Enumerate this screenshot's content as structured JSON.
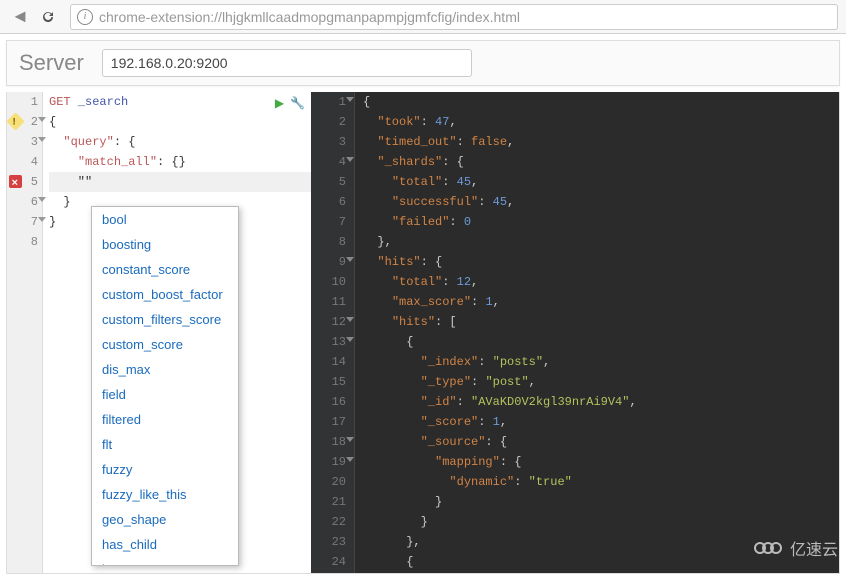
{
  "toolbar": {
    "url": "chrome-extension://lhjgkmllcaadmopgmanpapmpjgmfcfig/index.html"
  },
  "server": {
    "label": "Server",
    "value": "192.168.0.20:9200"
  },
  "request": {
    "method": "GET",
    "path": "_search",
    "lines": [
      {
        "n": "1",
        "mark": "",
        "content_type": "method"
      },
      {
        "n": "2",
        "mark": "warn",
        "content": "{"
      },
      {
        "n": "3",
        "mark": "",
        "content": "  \"query\": {"
      },
      {
        "n": "4",
        "mark": "",
        "content": "    \"match_all\": {}"
      },
      {
        "n": "5",
        "mark": "err",
        "content": "    \"\"",
        "active": true
      },
      {
        "n": "6",
        "mark": "",
        "content": "  }"
      },
      {
        "n": "7",
        "mark": "",
        "content": "}"
      },
      {
        "n": "8",
        "mark": "",
        "content": ""
      }
    ],
    "folds": [
      2,
      3,
      6,
      7
    ]
  },
  "autocomplete": {
    "items": [
      "bool",
      "boosting",
      "constant_score",
      "custom_boost_factor",
      "custom_filters_score",
      "custom_score",
      "dis_max",
      "field",
      "filtered",
      "flt",
      "fuzzy",
      "fuzzy_like_this",
      "geo_shape",
      "has_child",
      "has_parent"
    ]
  },
  "response": {
    "lines": [
      {
        "n": "1",
        "t": [
          [
            "jp",
            "{"
          ]
        ],
        "fold": true
      },
      {
        "n": "2",
        "t": [
          [
            "jp",
            "  "
          ],
          [
            "jk",
            "\"took\""
          ],
          [
            "jp",
            ": "
          ],
          [
            "jn",
            "47"
          ],
          [
            "jp",
            ","
          ]
        ]
      },
      {
        "n": "3",
        "t": [
          [
            "jp",
            "  "
          ],
          [
            "jk",
            "\"timed_out\""
          ],
          [
            "jp",
            ": "
          ],
          [
            "jb",
            "false"
          ],
          [
            "jp",
            ","
          ]
        ]
      },
      {
        "n": "4",
        "t": [
          [
            "jp",
            "  "
          ],
          [
            "jk",
            "\"_shards\""
          ],
          [
            "jp",
            ": {"
          ]
        ],
        "fold": true
      },
      {
        "n": "5",
        "t": [
          [
            "jp",
            "    "
          ],
          [
            "jk",
            "\"total\""
          ],
          [
            "jp",
            ": "
          ],
          [
            "jn",
            "45"
          ],
          [
            "jp",
            ","
          ]
        ]
      },
      {
        "n": "6",
        "t": [
          [
            "jp",
            "    "
          ],
          [
            "jk",
            "\"successful\""
          ],
          [
            "jp",
            ": "
          ],
          [
            "jn",
            "45"
          ],
          [
            "jp",
            ","
          ]
        ]
      },
      {
        "n": "7",
        "t": [
          [
            "jp",
            "    "
          ],
          [
            "jk",
            "\"failed\""
          ],
          [
            "jp",
            ": "
          ],
          [
            "jn",
            "0"
          ]
        ]
      },
      {
        "n": "8",
        "t": [
          [
            "jp",
            "  },"
          ]
        ]
      },
      {
        "n": "9",
        "t": [
          [
            "jp",
            "  "
          ],
          [
            "jk",
            "\"hits\""
          ],
          [
            "jp",
            ": {"
          ]
        ],
        "fold": true
      },
      {
        "n": "10",
        "t": [
          [
            "jp",
            "    "
          ],
          [
            "jk",
            "\"total\""
          ],
          [
            "jp",
            ": "
          ],
          [
            "jn",
            "12"
          ],
          [
            "jp",
            ","
          ]
        ]
      },
      {
        "n": "11",
        "t": [
          [
            "jp",
            "    "
          ],
          [
            "jk",
            "\"max_score\""
          ],
          [
            "jp",
            ": "
          ],
          [
            "jn",
            "1"
          ],
          [
            "jp",
            ","
          ]
        ]
      },
      {
        "n": "12",
        "t": [
          [
            "jp",
            "    "
          ],
          [
            "jk",
            "\"hits\""
          ],
          [
            "jp",
            ": ["
          ]
        ],
        "fold": true
      },
      {
        "n": "13",
        "t": [
          [
            "jp",
            "      {"
          ]
        ],
        "fold": true
      },
      {
        "n": "14",
        "t": [
          [
            "jp",
            "        "
          ],
          [
            "jk",
            "\"_index\""
          ],
          [
            "jp",
            ": "
          ],
          [
            "js",
            "\"posts\""
          ],
          [
            "jp",
            ","
          ]
        ]
      },
      {
        "n": "15",
        "t": [
          [
            "jp",
            "        "
          ],
          [
            "jk",
            "\"_type\""
          ],
          [
            "jp",
            ": "
          ],
          [
            "js",
            "\"post\""
          ],
          [
            "jp",
            ","
          ]
        ]
      },
      {
        "n": "16",
        "t": [
          [
            "jp",
            "        "
          ],
          [
            "jk",
            "\"_id\""
          ],
          [
            "jp",
            ": "
          ],
          [
            "js",
            "\"AVaKD0V2kgl39nrAi9V4\""
          ],
          [
            "jp",
            ","
          ]
        ]
      },
      {
        "n": "17",
        "t": [
          [
            "jp",
            "        "
          ],
          [
            "jk",
            "\"_score\""
          ],
          [
            "jp",
            ": "
          ],
          [
            "jn",
            "1"
          ],
          [
            "jp",
            ","
          ]
        ]
      },
      {
        "n": "18",
        "t": [
          [
            "jp",
            "        "
          ],
          [
            "jk",
            "\"_source\""
          ],
          [
            "jp",
            ": {"
          ]
        ],
        "fold": true
      },
      {
        "n": "19",
        "t": [
          [
            "jp",
            "          "
          ],
          [
            "jk",
            "\"mapping\""
          ],
          [
            "jp",
            ": {"
          ]
        ],
        "fold": true
      },
      {
        "n": "20",
        "t": [
          [
            "jp",
            "            "
          ],
          [
            "jk",
            "\"dynamic\""
          ],
          [
            "jp",
            ": "
          ],
          [
            "js",
            "\"true\""
          ]
        ]
      },
      {
        "n": "21",
        "t": [
          [
            "jp",
            "          }"
          ]
        ]
      },
      {
        "n": "22",
        "t": [
          [
            "jp",
            "        }"
          ]
        ]
      },
      {
        "n": "23",
        "t": [
          [
            "jp",
            "      },"
          ]
        ]
      },
      {
        "n": "24",
        "t": [
          [
            "jp",
            "      {"
          ]
        ]
      }
    ]
  },
  "watermark": {
    "text": "亿速云"
  }
}
